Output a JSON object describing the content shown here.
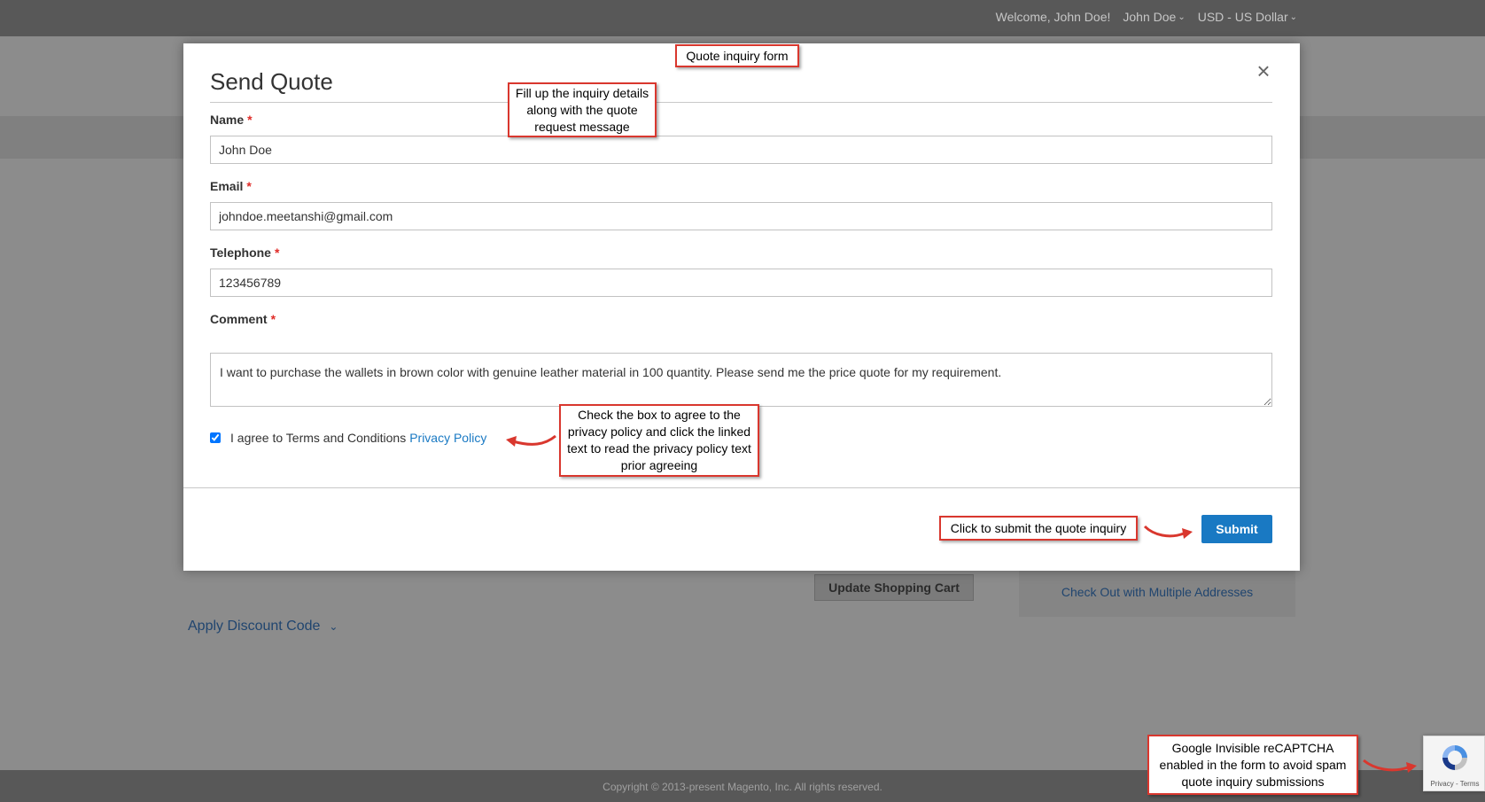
{
  "topbar": {
    "welcome": "Welcome, John Doe!",
    "account": "John Doe",
    "currency": "USD - US Dollar"
  },
  "page": {
    "update_cart": "Update Shopping Cart",
    "multi_address": "Check Out with Multiple Addresses",
    "discount": "Apply Discount Code"
  },
  "footer": {
    "copyright": "Copyright © 2013-present Magento, Inc. All rights reserved."
  },
  "recaptcha": {
    "terms": "Privacy - Terms"
  },
  "modal": {
    "title": "Send Quote",
    "close_symbol": "×",
    "name": {
      "label": "Name",
      "value": "John Doe"
    },
    "email": {
      "label": "Email",
      "value": "johndoe.meetanshi@gmail.com"
    },
    "telephone": {
      "label": "Telephone",
      "value": "123456789"
    },
    "comment": {
      "label": "Comment",
      "value": "I want to purchase the wallets in brown color with genuine leather material in 100 quantity. Please send me the price quote for my requirement."
    },
    "required_mark": "*",
    "agree_text": "I agree to Terms and Conditions",
    "privacy_link": "Privacy Policy",
    "agree_checked": true,
    "submit": "Submit"
  },
  "annotations": {
    "form": "Quote inquiry form",
    "fill": "Fill up the inquiry details along with the quote request message",
    "checkbox": "Check the box to agree to the privacy policy and click the linked text to read the privacy policy text prior agreeing",
    "submit": "Click to submit the quote inquiry",
    "recaptcha": "Google Invisible reCAPTCHA enabled in the form to avoid spam quote inquiry submissions"
  },
  "colors": {
    "accent": "#1979c3",
    "required": "#e02b27",
    "annotation_border": "#d9372e",
    "overlay": "#8c8c8c"
  }
}
